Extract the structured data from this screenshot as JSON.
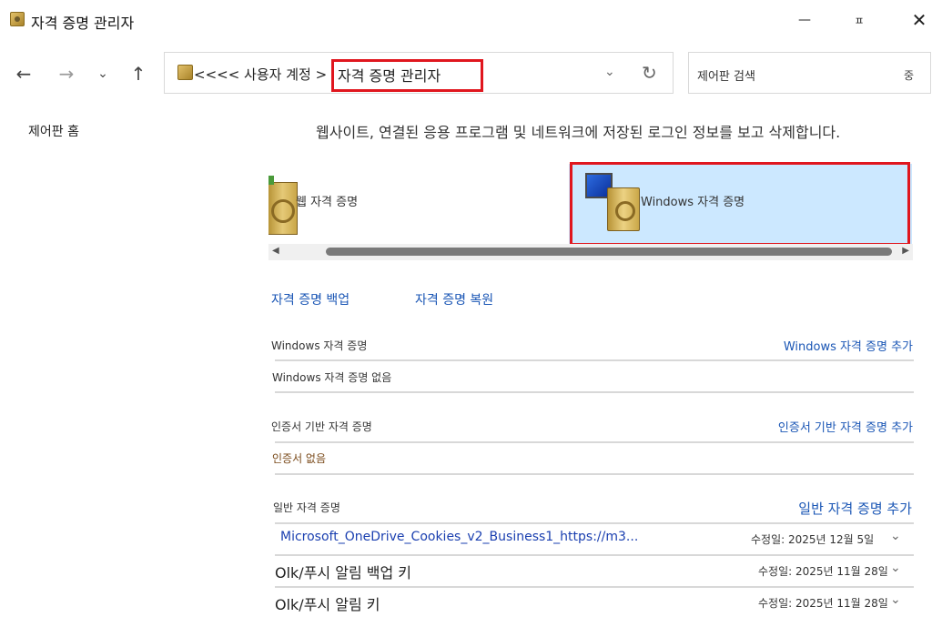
{
  "window": {
    "title": "자격 증명 관리자",
    "min_glyph": "—",
    "max_glyph": "ㅍ",
    "close_glyph": "✕"
  },
  "nav": {
    "back_glyph": "←",
    "forward_glyph": "→",
    "recent_glyph": "⌄",
    "up_glyph": "↑",
    "address_prefix": "<<<< 사용자 계정 >",
    "address_current": "자격 증명 관리자",
    "dropdown_glyph": "⌄",
    "refresh_glyph": "↻",
    "search_placeholder": "제어판 검색",
    "search_glyph": "중"
  },
  "sidebar": {
    "home_label": "제어판 홈"
  },
  "main": {
    "description": "웹사이트, 연결된 응용 프로그램 및 네트워크에 저장된 로그인 정보를 보고 삭제합니다.",
    "tiles": {
      "web_label": "웹 자격 증명",
      "windows_label": "Windows 자격 증명"
    },
    "scroll": {
      "left_glyph": "◀",
      "right_glyph": "▶"
    },
    "backup_label": "자격 증명 백업",
    "restore_label": "자격 증명 복원",
    "windows_section": {
      "title": "Windows 자격 증명",
      "add_label": "Windows 자격 증명 추가",
      "empty_text": "Windows 자격 증명 없음"
    },
    "cert_section": {
      "title": "인증서 기반 자격 증명",
      "add_label": "인증서 기반 자격 증명 추가",
      "empty_text": "인증서 없음"
    },
    "generic_section": {
      "title": "일반 자격 증명",
      "add_label": "일반 자격 증명 추가",
      "items": [
        {
          "name": "Microsoft_OneDrive_Cookies_v2_Business1_https://m3...",
          "date": "수정일: 2025년 12월 5일"
        },
        {
          "name": "Olk/푸시 알림 백업 키",
          "date": "수정일: 2025년 11월 28일"
        },
        {
          "name": "Olk/푸시 알림 키",
          "date": "수정일: 2025년 11월 28일"
        }
      ]
    }
  },
  "colors": {
    "accent_link": "#1a56b5",
    "highlight_red": "#e0161e",
    "selected_tile": "#cce8ff"
  }
}
